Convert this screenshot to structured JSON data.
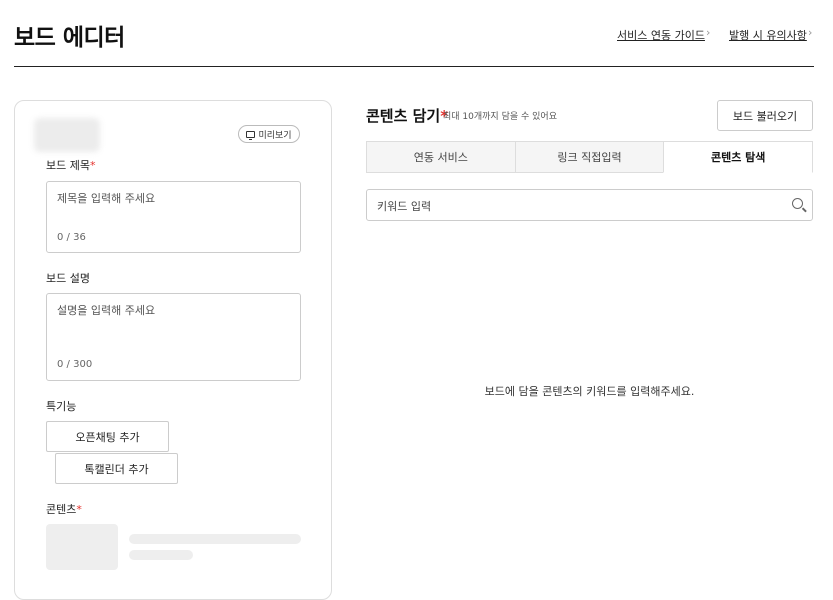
{
  "header": {
    "title": "보드 에디터",
    "links": [
      {
        "label": "서비스 연동 가이드"
      },
      {
        "label": "발행 시 유의사항"
      }
    ]
  },
  "left_panel": {
    "preview_label": "미리보기",
    "title_field": {
      "label": "보드 제목",
      "placeholder": "제목을 입력해 주세요",
      "counter": "0 / 36"
    },
    "desc_field": {
      "label": "보드 설명",
      "placeholder": "설명을 입력해 주세요",
      "counter": "0 / 300"
    },
    "special_features": {
      "label": "특기능",
      "buttons": [
        "오픈채팅 추가",
        "톡캘린더 추가"
      ]
    },
    "contents_label": "콘텐츠"
  },
  "right_panel": {
    "title": "콘텐츠 담기",
    "subtitle": "최대 10개까지 담을 수 있어요",
    "load_button": "보드 불러오기",
    "tabs": [
      {
        "label": "연동 서비스",
        "active": false
      },
      {
        "label": "링크 직접입력",
        "active": false
      },
      {
        "label": "콘텐츠 탐색",
        "active": true
      }
    ],
    "search_placeholder": "키워드 입력",
    "empty_message": "보드에 담을 콘텐츠의 키워드를 입력해주세요."
  },
  "icons": {
    "preview": "monitor-icon",
    "search": "search-icon",
    "chevron": "chevron-right-icon"
  },
  "colors": {
    "required": "#e5322d",
    "tab_inactive_bg": "#f5f5f5"
  }
}
